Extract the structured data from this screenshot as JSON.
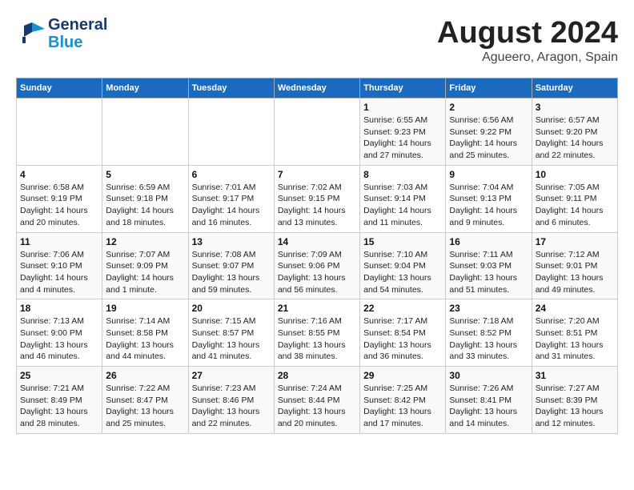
{
  "header": {
    "logo_general": "General",
    "logo_blue": "Blue",
    "month_title": "August 2024",
    "location": "Agueero, Aragon, Spain"
  },
  "days_of_week": [
    "Sunday",
    "Monday",
    "Tuesday",
    "Wednesday",
    "Thursday",
    "Friday",
    "Saturday"
  ],
  "weeks": [
    [
      {
        "day": "",
        "info": ""
      },
      {
        "day": "",
        "info": ""
      },
      {
        "day": "",
        "info": ""
      },
      {
        "day": "",
        "info": ""
      },
      {
        "day": "1",
        "info": "Sunrise: 6:55 AM\nSunset: 9:23 PM\nDaylight: 14 hours\nand 27 minutes."
      },
      {
        "day": "2",
        "info": "Sunrise: 6:56 AM\nSunset: 9:22 PM\nDaylight: 14 hours\nand 25 minutes."
      },
      {
        "day": "3",
        "info": "Sunrise: 6:57 AM\nSunset: 9:20 PM\nDaylight: 14 hours\nand 22 minutes."
      }
    ],
    [
      {
        "day": "4",
        "info": "Sunrise: 6:58 AM\nSunset: 9:19 PM\nDaylight: 14 hours\nand 20 minutes."
      },
      {
        "day": "5",
        "info": "Sunrise: 6:59 AM\nSunset: 9:18 PM\nDaylight: 14 hours\nand 18 minutes."
      },
      {
        "day": "6",
        "info": "Sunrise: 7:01 AM\nSunset: 9:17 PM\nDaylight: 14 hours\nand 16 minutes."
      },
      {
        "day": "7",
        "info": "Sunrise: 7:02 AM\nSunset: 9:15 PM\nDaylight: 14 hours\nand 13 minutes."
      },
      {
        "day": "8",
        "info": "Sunrise: 7:03 AM\nSunset: 9:14 PM\nDaylight: 14 hours\nand 11 minutes."
      },
      {
        "day": "9",
        "info": "Sunrise: 7:04 AM\nSunset: 9:13 PM\nDaylight: 14 hours\nand 9 minutes."
      },
      {
        "day": "10",
        "info": "Sunrise: 7:05 AM\nSunset: 9:11 PM\nDaylight: 14 hours\nand 6 minutes."
      }
    ],
    [
      {
        "day": "11",
        "info": "Sunrise: 7:06 AM\nSunset: 9:10 PM\nDaylight: 14 hours\nand 4 minutes."
      },
      {
        "day": "12",
        "info": "Sunrise: 7:07 AM\nSunset: 9:09 PM\nDaylight: 14 hours\nand 1 minute."
      },
      {
        "day": "13",
        "info": "Sunrise: 7:08 AM\nSunset: 9:07 PM\nDaylight: 13 hours\nand 59 minutes."
      },
      {
        "day": "14",
        "info": "Sunrise: 7:09 AM\nSunset: 9:06 PM\nDaylight: 13 hours\nand 56 minutes."
      },
      {
        "day": "15",
        "info": "Sunrise: 7:10 AM\nSunset: 9:04 PM\nDaylight: 13 hours\nand 54 minutes."
      },
      {
        "day": "16",
        "info": "Sunrise: 7:11 AM\nSunset: 9:03 PM\nDaylight: 13 hours\nand 51 minutes."
      },
      {
        "day": "17",
        "info": "Sunrise: 7:12 AM\nSunset: 9:01 PM\nDaylight: 13 hours\nand 49 minutes."
      }
    ],
    [
      {
        "day": "18",
        "info": "Sunrise: 7:13 AM\nSunset: 9:00 PM\nDaylight: 13 hours\nand 46 minutes."
      },
      {
        "day": "19",
        "info": "Sunrise: 7:14 AM\nSunset: 8:58 PM\nDaylight: 13 hours\nand 44 minutes."
      },
      {
        "day": "20",
        "info": "Sunrise: 7:15 AM\nSunset: 8:57 PM\nDaylight: 13 hours\nand 41 minutes."
      },
      {
        "day": "21",
        "info": "Sunrise: 7:16 AM\nSunset: 8:55 PM\nDaylight: 13 hours\nand 38 minutes."
      },
      {
        "day": "22",
        "info": "Sunrise: 7:17 AM\nSunset: 8:54 PM\nDaylight: 13 hours\nand 36 minutes."
      },
      {
        "day": "23",
        "info": "Sunrise: 7:18 AM\nSunset: 8:52 PM\nDaylight: 13 hours\nand 33 minutes."
      },
      {
        "day": "24",
        "info": "Sunrise: 7:20 AM\nSunset: 8:51 PM\nDaylight: 13 hours\nand 31 minutes."
      }
    ],
    [
      {
        "day": "25",
        "info": "Sunrise: 7:21 AM\nSunset: 8:49 PM\nDaylight: 13 hours\nand 28 minutes."
      },
      {
        "day": "26",
        "info": "Sunrise: 7:22 AM\nSunset: 8:47 PM\nDaylight: 13 hours\nand 25 minutes."
      },
      {
        "day": "27",
        "info": "Sunrise: 7:23 AM\nSunset: 8:46 PM\nDaylight: 13 hours\nand 22 minutes."
      },
      {
        "day": "28",
        "info": "Sunrise: 7:24 AM\nSunset: 8:44 PM\nDaylight: 13 hours\nand 20 minutes."
      },
      {
        "day": "29",
        "info": "Sunrise: 7:25 AM\nSunset: 8:42 PM\nDaylight: 13 hours\nand 17 minutes."
      },
      {
        "day": "30",
        "info": "Sunrise: 7:26 AM\nSunset: 8:41 PM\nDaylight: 13 hours\nand 14 minutes."
      },
      {
        "day": "31",
        "info": "Sunrise: 7:27 AM\nSunset: 8:39 PM\nDaylight: 13 hours\nand 12 minutes."
      }
    ]
  ]
}
